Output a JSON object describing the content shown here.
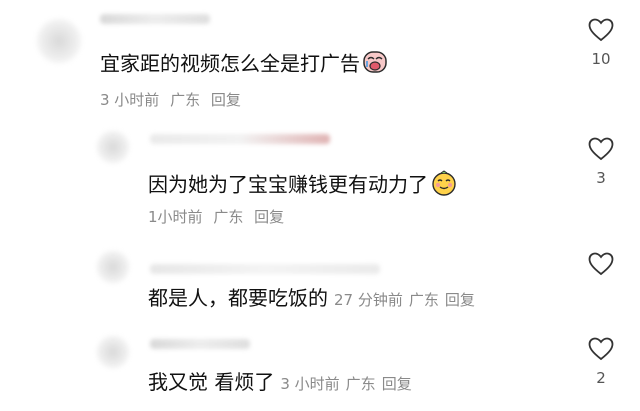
{
  "comments": [
    {
      "text": "宜家距的视频怎么全是打广告",
      "emoji": "crying-face",
      "time": "3 小时前",
      "location": "广东",
      "reply": "回复",
      "likes": "10"
    },
    {
      "text": "因为她为了宝宝赚钱更有动力了",
      "emoji": "smirking-face",
      "time": "1小时前",
      "location": "广东",
      "reply": "回复",
      "likes": "3"
    },
    {
      "text": "都是人，都要吃饭的",
      "time": "27 分钟前",
      "location": "广东",
      "reply": "回复",
      "likes": ""
    },
    {
      "text": "我又觉 看烦了",
      "time": "3 小时前",
      "location": "广东",
      "reply": "回复",
      "likes": "2"
    }
  ],
  "colors": {
    "text": "#111111",
    "meta": "#8a8a8a",
    "heart_stroke": "#333333"
  }
}
